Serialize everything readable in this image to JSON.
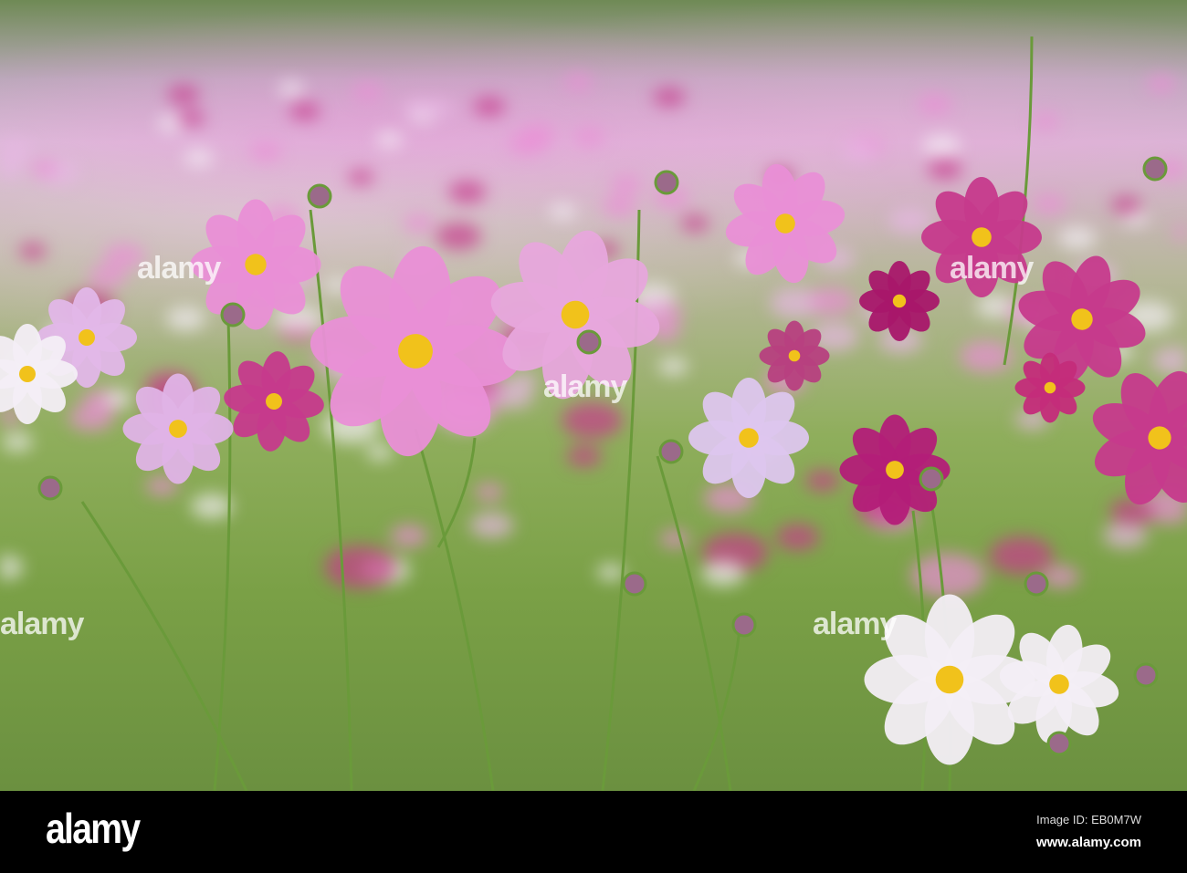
{
  "photo": {
    "subject": "cosmos flowers",
    "watermark": "alamy",
    "colors": {
      "pink": "#e98fd6",
      "magenta": "#c63a8c",
      "white": "#f3eef5",
      "center": "#f1c21b",
      "stem": "#6a9a3a"
    }
  },
  "footer": {
    "logo": "alamy",
    "image_id": "Image ID: EB0M7W",
    "site": "www.alamy.com"
  }
}
